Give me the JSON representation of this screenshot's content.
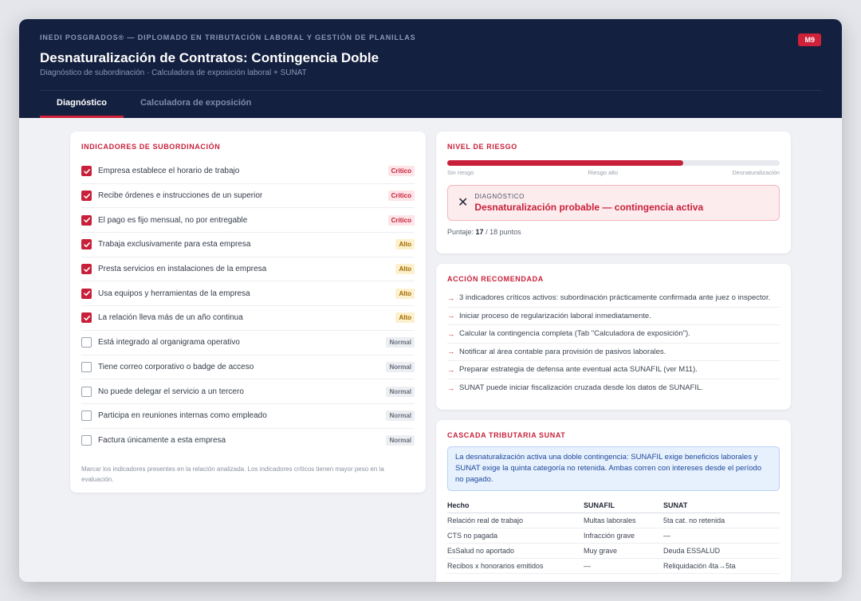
{
  "header": {
    "eyebrow": "INEDI POSGRADOS® — DIPLOMADO EN TRIBUTACIÓN LABORAL Y GESTIÓN DE PLANILLAS",
    "badge": "M9",
    "title": "Desnaturalización de Contratos: Contingencia Doble",
    "subtitle": "Diagnóstico de subordinación · Calculadora de exposición laboral + SUNAT",
    "tabs": [
      {
        "label": "Diagnóstico",
        "active": true
      },
      {
        "label": "Calculadora de exposición",
        "active": false
      }
    ]
  },
  "indicators": {
    "title": "INDICADORES DE SUBORDINACIÓN",
    "items": [
      {
        "label": "Empresa establece el horario de trabajo",
        "checked": true,
        "level": "Crítico"
      },
      {
        "label": "Recibe órdenes e instrucciones de un superior",
        "checked": true,
        "level": "Crítico"
      },
      {
        "label": "El pago es fijo mensual, no por entregable",
        "checked": true,
        "level": "Crítico"
      },
      {
        "label": "Trabaja exclusivamente para esta empresa",
        "checked": true,
        "level": "Alto"
      },
      {
        "label": "Presta servicios en instalaciones de la empresa",
        "checked": true,
        "level": "Alto"
      },
      {
        "label": "Usa equipos y herramientas de la empresa",
        "checked": true,
        "level": "Alto"
      },
      {
        "label": "La relación lleva más de un año continua",
        "checked": true,
        "level": "Alto"
      },
      {
        "label": "Está integrado al organigrama operativo",
        "checked": false,
        "level": "Normal"
      },
      {
        "label": "Tiene correo corporativo o badge de acceso",
        "checked": false,
        "level": "Normal"
      },
      {
        "label": "No puede delegar el servicio a un tercero",
        "checked": false,
        "level": "Normal"
      },
      {
        "label": "Participa en reuniones internas como empleado",
        "checked": false,
        "level": "Normal"
      },
      {
        "label": "Factura únicamente a esta empresa",
        "checked": false,
        "level": "Normal"
      }
    ],
    "note": "Marcar los indicadores presentes en la relación analizada. Los indicadores críticos tienen mayor peso en la evaluación."
  },
  "risk": {
    "title": "NIVEL DE RIESGO",
    "level_fraction": 0.71,
    "labels": [
      "Sin riesgo",
      "Riesgo alto",
      "Desnaturalización"
    ],
    "diag_kicker": "DIAGNÓSTICO",
    "diag_text": "Desnaturalización probable — contingencia activa",
    "score_prefix": "Puntaje:",
    "score_value": "17",
    "score_suffix": "/ 18 puntos"
  },
  "action": {
    "title": "ACCIÓN RECOMENDADA",
    "items": [
      "3 indicadores críticos activos: subordinación prácticamente confirmada ante juez o inspector.",
      "Iniciar proceso de regularización laboral inmediatamente.",
      "Calcular la contingencia completa (Tab \"Calculadora de exposición\").",
      "Notificar al área contable para provisión de pasivos laborales.",
      "Preparar estrategia de defensa ante eventual acta SUNAFIL (ver M11).",
      "SUNAT puede iniciar fiscalización cruzada desde los datos de SUNAFIL."
    ]
  },
  "cascade": {
    "title": "CASCADA TRIBUTARIA SUNAT",
    "info": "La desnaturalización activa una doble contingencia: SUNAFIL exige beneficios laborales y SUNAT exige la quinta categoría no retenida. Ambas corren con intereses desde el período no pagado.",
    "headers": [
      "Hecho",
      "SUNAFIL",
      "SUNAT"
    ],
    "rows": [
      [
        "Relación real de trabajo",
        "Multas laborales",
        "5ta cat. no retenida"
      ],
      [
        "CTS no pagada",
        "Infracción grave",
        "—"
      ],
      [
        "EsSalud no aportado",
        "Muy grave",
        "Deuda ESSALUD"
      ],
      [
        "Recibos x honorarios emitidos",
        "—",
        "Reliquidación 4ta→5ta"
      ]
    ]
  },
  "colors": {
    "navy": "#14203f",
    "accent": "#c8203a"
  }
}
